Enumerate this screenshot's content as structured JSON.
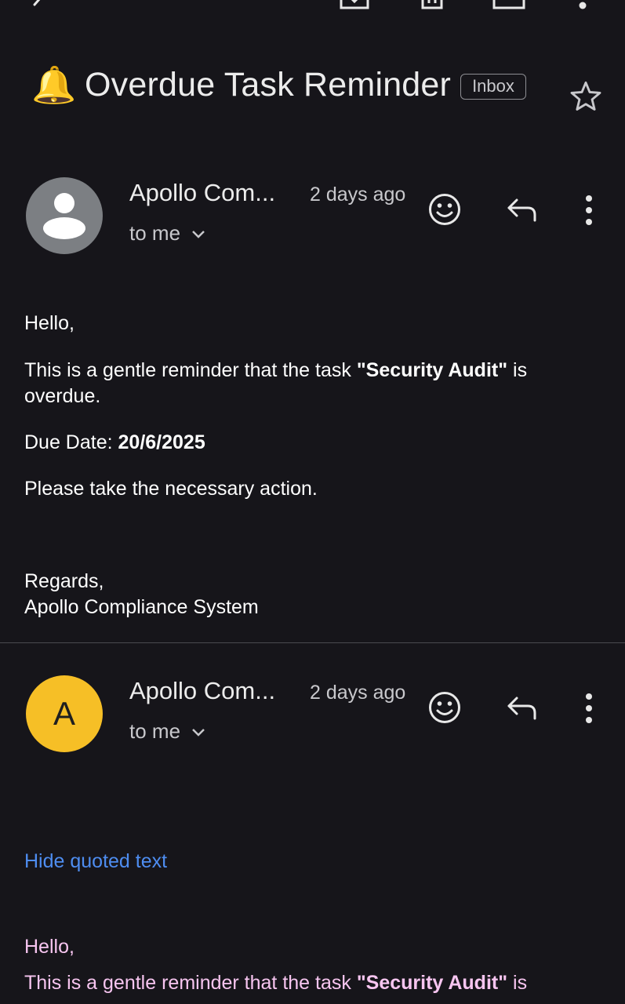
{
  "toolbar": {
    "icons": [
      "back-arrow-icon",
      "archive-icon",
      "delete-icon",
      "mail-icon",
      "more-vertical-icon"
    ]
  },
  "subject": {
    "emoji": "🔔",
    "text": "Overdue Task Reminder",
    "label": "Inbox",
    "star_icon": "star-outline-icon"
  },
  "messages": [
    {
      "sender": "Apollo Com...",
      "time": "2 days ago",
      "recipient": "to me",
      "avatar_type": "generic-person",
      "avatar_color": "#7c7f83",
      "body": {
        "greeting": "Hello,",
        "line1_prefix": "This is a gentle reminder that the task ",
        "task_name": "\"Security Audit\"",
        "line1_suffix": " is overdue.",
        "due_label": "Due Date: ",
        "due_value": "20/6/2025",
        "action": "Please take the necessary action.",
        "regards": "Regards,",
        "signature": "Apollo Compliance System"
      }
    },
    {
      "sender": "Apollo Com...",
      "time": "2 days ago",
      "recipient": "to me",
      "avatar_letter": "A",
      "avatar_color": "#f6bf26",
      "hide_quoted": "Hide quoted text",
      "quoted": {
        "greeting": "Hello,",
        "line1_prefix": "This is a gentle reminder that the task ",
        "task_name": "\"Security Audit\"",
        "line1_suffix": " is"
      }
    }
  ],
  "colors": {
    "background": "#16151a",
    "link": "#4e8df0",
    "quoted_text": "#f7c5f0"
  }
}
